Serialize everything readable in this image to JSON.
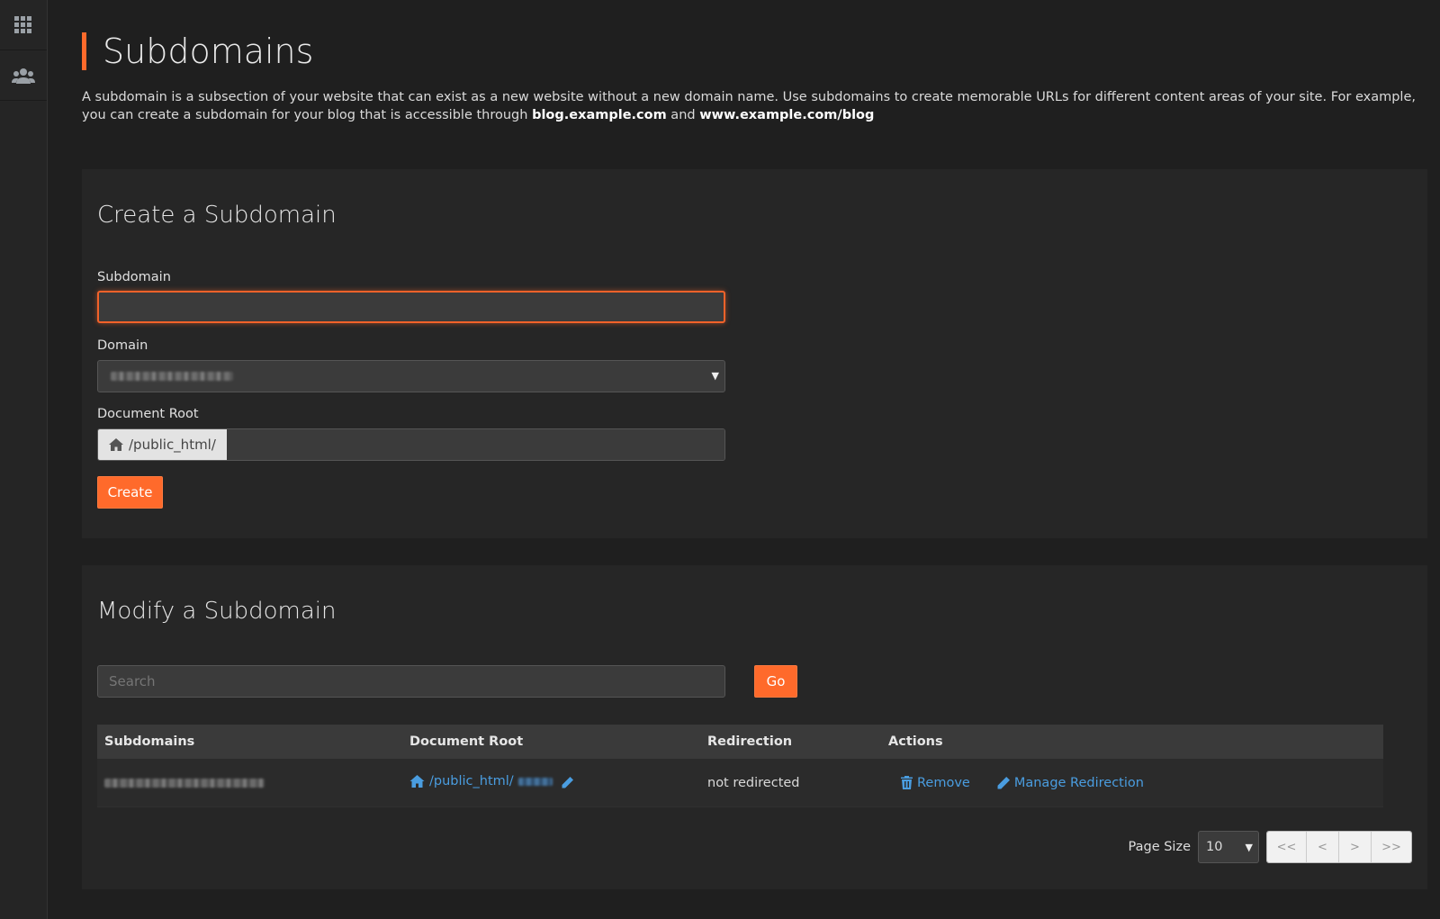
{
  "rail": {
    "items": [
      {
        "icon": "grid-icon"
      },
      {
        "icon": "users-icon"
      }
    ]
  },
  "page": {
    "title": "Subdomains",
    "intro_parts": [
      "A subdomain is a subsection of your website that can exist as a new website without a new domain name. Use subdomains to create memorable URLs for different content areas of your site. For example, you can create a subdomain for your blog that is accessible through ",
      "blog.example.com",
      " and ",
      "www.example.com/blog"
    ],
    "accent_color": "#ff6a2b",
    "link_color": "#4a9de0"
  },
  "create": {
    "title": "Create a Subdomain",
    "subdomain_label": "Subdomain",
    "subdomain_value": "",
    "domain_label": "Domain",
    "docroot_label": "Document Root",
    "docroot_prefix": "/public_html/",
    "docroot_value": "",
    "create_button": "Create"
  },
  "modify": {
    "title": "Modify a Subdomain",
    "search_placeholder": "Search",
    "go_button": "Go",
    "columns": [
      "Subdomains",
      "Document Root",
      "Redirection",
      "Actions"
    ],
    "rows": [
      {
        "docroot_text": "/public_html/",
        "redirection": "not redirected",
        "remove_label": "Remove",
        "manage_label": "Manage Redirection"
      }
    ],
    "page_size_label": "Page Size",
    "page_size_value": "10",
    "pager": [
      "<<",
      "<",
      ">",
      ">>"
    ]
  }
}
